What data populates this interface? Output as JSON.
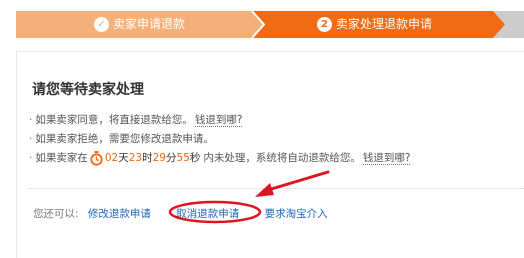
{
  "steps": [
    {
      "label": "卖家申请退款",
      "status": "done",
      "marker": "✓"
    },
    {
      "label": "卖家处理退款申请",
      "status": "current",
      "marker": "2"
    }
  ],
  "main": {
    "title": "请您等待卖家处理",
    "bullets": {
      "b1_text": "如果卖家同意，将直接退款给您。",
      "b1_link": "钱退到哪?",
      "b2_text": "如果卖家拒绝，需要您修改退款申请。",
      "b3_prefix": "如果卖家在",
      "b3_suffix": "内未处理，系统将自动退款给您。",
      "b3_link": "钱退到哪?"
    },
    "countdown": {
      "days": "02",
      "day_unit": "天",
      "hours": "23",
      "hour_unit": "时",
      "minutes": "29",
      "minute_unit": "分",
      "seconds": "55",
      "second_unit": "秒"
    },
    "actions": {
      "prefix": "您还可以:",
      "modify": "修改退款申请",
      "cancel": "取消退款申请",
      "escalate": "要求淘宝介入"
    }
  },
  "colors": {
    "step_done": "#f5b07a",
    "step_current": "#f26a13",
    "step_next": "#cccccc",
    "link": "#1d67bf",
    "accent": "#f26a13",
    "annotation": "#e0141e"
  },
  "bullet_glyph": "·"
}
